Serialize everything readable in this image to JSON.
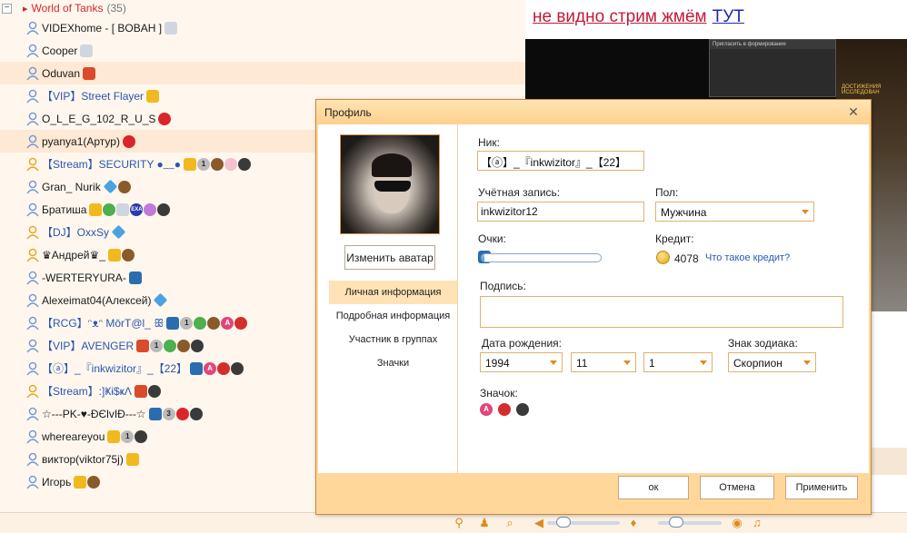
{
  "room": {
    "toggle": "−",
    "flag_icon": "flag-icon",
    "name": "World of Tanks",
    "count": "(35)"
  },
  "users": [
    {
      "nick": "VIDEXhome  -  [ BOBAH ]",
      "highlight": false
    },
    {
      "nick": "Cooper",
      "highlight": false
    },
    {
      "nick": "Oduvan",
      "highlight": true
    },
    {
      "nick": "【VIP】Street Flayer",
      "highlight": false
    },
    {
      "nick": "O_L_E_G_102_R_U_S",
      "highlight": false
    },
    {
      "nick": "pyanya1(Артур)",
      "highlight": true
    },
    {
      "nick": "【Stream】SECURITY ●﹏●",
      "highlight": false
    },
    {
      "nick": "Gran_ Nurik",
      "highlight": false
    },
    {
      "nick": "Братиша",
      "highlight": false
    },
    {
      "nick": "【DJ】OxxSy",
      "highlight": false
    },
    {
      "nick": "♛Андрей♛_",
      "highlight": false
    },
    {
      "nick": "-WERTERYURA-",
      "highlight": false
    },
    {
      "nick": "Alexeimat04(Алексей)",
      "highlight": false
    },
    {
      "nick": "【RCG】ᵔᴥᵔ MōrT@l_ ꕥ",
      "highlight": false
    },
    {
      "nick": "【VIP】AVENGER",
      "highlight": false
    },
    {
      "nick": "【ⓐ】_『inkwizitor』_【22】",
      "highlight": false
    },
    {
      "nick": "【Stream】:]Ҝɨ$ҝΛ",
      "highlight": false
    },
    {
      "nick": "☆---PK-♥-ÐЄlvIÐ---☆",
      "highlight": false
    },
    {
      "nick": "whereareyou",
      "highlight": false
    },
    {
      "nick": "виктор(viktor75j)",
      "highlight": false
    },
    {
      "nick": "Игорь",
      "highlight": false
    }
  ],
  "badge_labels": {
    "num1": "1",
    "num3": "3",
    "exa": "EXA",
    "a": "A"
  },
  "stream": {
    "text": "не видно стрим жмём",
    "link": "ТУТ"
  },
  "video": {
    "inner_title": "Пригласить в формирование",
    "game_tab": "ДОСТИЖЕНИЯ  ИССЛЕДОВАН"
  },
  "dialog": {
    "title": "Профиль",
    "close_icon": "close-icon",
    "change_avatar": "Изменить аватар",
    "nav": [
      "Личная информация",
      "Подробная информация",
      "Участник в группах",
      "Значки"
    ],
    "nav_active": 0,
    "nick_label": "Ник:",
    "nick_value": "【ⓐ】_『inkwizitor』_【22】",
    "account_label": "Учётная запись:",
    "account_value": "inkwizitor12",
    "gender_label": "Пол:",
    "gender_value": "Мужчина",
    "points_label": "Очки:",
    "points_progress": 0.02,
    "credit_label": "Кредит:",
    "credit_value": "4078",
    "credit_link": "Что такое кредит?",
    "signature_label": "Подпись:",
    "signature_value": "",
    "birthday_label": "Дата рождения:",
    "birth_year": "1994",
    "birth_month": "11",
    "birth_day": "1",
    "zodiac_label": "Знак зодиака:",
    "zodiac_value": "Скорпион",
    "badge_label": "Значок:",
    "ok": "ок",
    "cancel": "Отмена",
    "apply": "Применить"
  },
  "toolbar_icons": [
    "location-icon",
    "user-icon",
    "search-icon",
    "speaker-icon",
    "mic-icon",
    "record-icon",
    "music-icon"
  ],
  "colors": {
    "accent": "#e08a1c",
    "room_name": "#d7262c",
    "link": "#1a2ab5",
    "dialog_border": "#c78a3d"
  }
}
